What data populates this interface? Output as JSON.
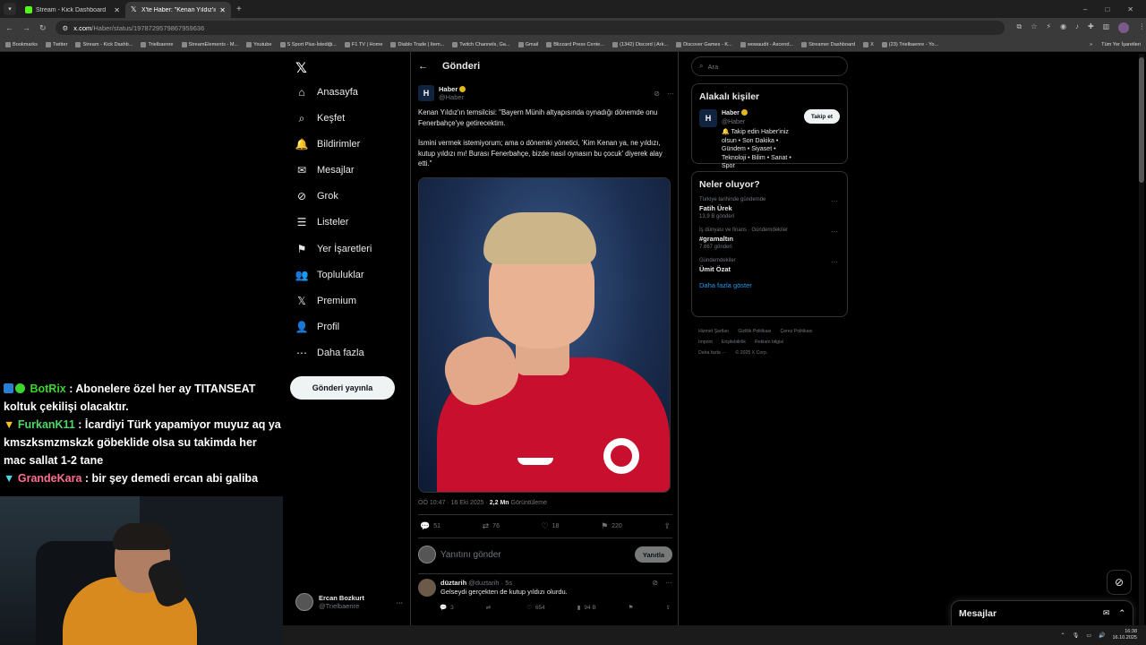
{
  "browser": {
    "tabs": [
      {
        "label": "Stream - Kick Dashboard",
        "active": false
      },
      {
        "label": "X'te Haber: \"Kenan Yıldız'ın tem",
        "active": true
      }
    ],
    "new_tab": "+",
    "url_host": "x.com",
    "url_path": "/Haber/status/1978729579867959636",
    "bookmarks": [
      "Bookmarks",
      "Twitter",
      "Stream - Kick Dashb...",
      "Trielbaenre",
      "StreamElements - M...",
      "Youtube",
      "S Sport Plus-İstediği...",
      "F1 TV | Home",
      "Diablo Trade | Item...",
      "Twitch Channels, Ga...",
      "Gmail",
      "Blizzard Press Cente...",
      "(1342) Discord | Ark...",
      "Discover Games - K...",
      "wowaudit - Ascend...",
      "Streamer Dashboard",
      "X",
      "(23) Trielbaenre - Yo..."
    ],
    "bookmarks_more": "»",
    "all_bookmarks": "Tüm Yer İşaretleri"
  },
  "chat": [
    {
      "user": "BotRix",
      "text": " : Abonelere özel her ay TITANSEAT koltuk çekilişi olacaktır."
    },
    {
      "user": "FurkanK11",
      "text": " : İcardiyi Türk yapamiyor muyuz aq ya kmszksmzmskzk göbeklide olsa su takimda her mac sallat 1-2 tane"
    },
    {
      "user": "GrandeKara",
      "text": " : bir şey demedi ercan abi galiba"
    }
  ],
  "nav": {
    "logo": "𝕏",
    "items": [
      {
        "label": "Anasayfa",
        "icon": "⌂"
      },
      {
        "label": "Keşfet",
        "icon": "⌕"
      },
      {
        "label": "Bildirimler",
        "icon": "🔔"
      },
      {
        "label": "Mesajlar",
        "icon": "✉"
      },
      {
        "label": "Grok",
        "icon": "⊘"
      },
      {
        "label": "Listeler",
        "icon": "☰"
      },
      {
        "label": "Yer İşaretleri",
        "icon": "⚑"
      },
      {
        "label": "Topluluklar",
        "icon": "👥"
      },
      {
        "label": "Premium",
        "icon": "𝕏"
      },
      {
        "label": "Profil",
        "icon": "👤"
      },
      {
        "label": "Daha fazla",
        "icon": "⋯"
      }
    ],
    "post_button": "Gönderi yayınla",
    "account_name": "Ercan Bozkurt",
    "account_handle": "@Trielbaenre",
    "account_more": "···"
  },
  "main": {
    "back": "←",
    "title": "Gönderi",
    "author_name": "Haber",
    "author_handle": "@Haber",
    "author_logo": "H",
    "text_p1": "Kenan Yıldız'ın temsilcisi: \"Bayern Münih altyapısında oynadığı dönemde onu Fenerbahçe'ye getirecektim.",
    "text_p2": "İsmini vermek istemiyorum; ama o dönemki yönetici, 'Kim Kenan ya, ne yıldızı, kutup yıldızı mı! Burası Fenerbahçe, bizde nasıl oynasın bu çocuk' diyerek alay etti.\"",
    "meta_time": "ÖÖ 10:47 · 16 Eki 2025 · ",
    "meta_views": "2,2 Mn",
    "meta_views_label": " Görüntüleme",
    "stats": {
      "replies": "51",
      "reposts": "76",
      "likes": "18",
      "bookmarks": "220"
    },
    "reply_placeholder": "Yanıtını gönder",
    "reply_button": "Yanıtla",
    "reply": {
      "name": "düztarih",
      "handle": "@duztarih · 5s",
      "text": "Gelseydi gerçekten de kutup yıldızı olurdu.",
      "replies": "3",
      "reposts": "",
      "likes": "654",
      "views": "94 B"
    }
  },
  "right": {
    "search_placeholder": "Ara",
    "people_title": "Alakalı kişiler",
    "person_name": "Haber",
    "person_handle": "@Haber",
    "person_bio": "🔔 Takip edin Haber'iniz olsun • Son Dakika • Gündem • Siyaset • Teknoloji • Bilim • Sanat • Spor",
    "follow_button": "Takip et",
    "trends_title": "Neler oluyor?",
    "trends": [
      {
        "context": "Türkiye tarihinde gündemde",
        "name": "Fatih Ürek",
        "count": "13,9 B gönderi"
      },
      {
        "context": "İş dünyası ve finans · Gündemdekiler",
        "name": "#gramaltın",
        "count": "7.667 gönderi"
      },
      {
        "context": "Gündemdekiler",
        "name": "Ümit Özat",
        "count": ""
      }
    ],
    "show_more": "Daha fazla göster",
    "footer": [
      "Hizmet Şartları",
      "Gizlilik Politikası",
      "Çerez Politikası",
      "Imprint",
      "Erişilebilirlik",
      "Reklam bilgisi",
      "Daha fazla ···",
      "© 2025 X Corp."
    ]
  },
  "drawer": {
    "title": "Mesajlar"
  },
  "taskbar": {
    "time": "16:38",
    "date": "16.10.2025"
  }
}
